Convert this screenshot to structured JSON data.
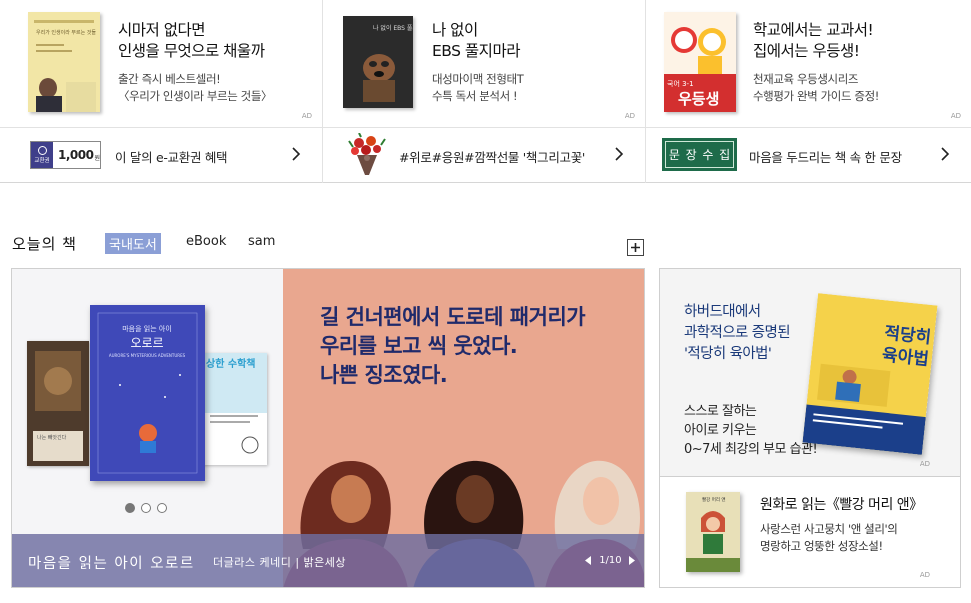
{
  "top_ads": [
    {
      "title": "시마저 없다면\n인생을 무엇으로 채울까",
      "subtitle": "출간 즉시 베스트셀러!\n〈우리가 인생이라 부르는 것들〉",
      "cover_text": "우리가 인생이라 부르는 것들",
      "ad_mark": "AD"
    },
    {
      "title": "나 없이\nEBS 풀지마라",
      "subtitle": "대성마이맥 전형태T\n수특 독서 분석서 !",
      "cover_text": "나 없이 EBS 풀지마라",
      "ad_mark": "AD"
    },
    {
      "title": "학교에서는 교과서!\n집에서는 우등생!",
      "subtitle": "천재교육 우등생시리즈\n수행평가 완벽 가이드 증정!",
      "cover_text": "우등생",
      "cover_sub": "국어 3-1",
      "ad_mark": "AD"
    }
  ],
  "links": [
    {
      "badge_label": "교환권",
      "badge_amount": "1,000",
      "badge_unit": "원",
      "text": "이 달의 e-교환권 혜택"
    },
    {
      "text": "#위로#응원#깜짝선물 '책그리고꽃'"
    },
    {
      "stamp": [
        "문",
        "장",
        "수",
        "집"
      ],
      "text": "마음을 두드리는 책 속 한 문장"
    }
  ],
  "section": {
    "title": "오늘의 책",
    "tabs": [
      "국내도서",
      "eBook",
      "sam"
    ],
    "active_tab": 0
  },
  "banner": {
    "quote": "길 건너편에서 도로테 패거리가\n우리를 보고 씩 웃었다.\n나쁜 징조였다.",
    "book_title": "마음을 읽는 아이 오로르",
    "author_publisher": "더글라스 케네디 | 밝은세상",
    "pager": "1/10",
    "cover_main_top": "마음을 읽는 아이",
    "cover_main_title": "오로르",
    "cover_main_sub": "AURORE'S MYSTERIOUS ADVENTURES",
    "cover_right_text": "상한 수학책",
    "cover_left_text": "나는 빼앗긴다"
  },
  "side_ad1": {
    "title": "하버드대에서\n과학적으로 증명된\n'적당히 육아법'",
    "subtitle": "스스로 잘하는\n아이로 키우는\n0~7세 최강의 부모 습관!",
    "cover_text": "적당히\n육아법",
    "ad_mark": "AD"
  },
  "side_ad2": {
    "title": "원화로 읽는《빨강 머리 앤》",
    "subtitle": "사랑스런 사고뭉치 '앤 셜리'의\n명랑하고 엉뚱한 성장소설!",
    "cover_text": "빨강 머리 앤",
    "ad_mark": "AD"
  },
  "colors": {
    "tab_active_bg": "#8b9fd6",
    "banner_right_bg": "#e9a78f",
    "quote_text": "#1f2a6b",
    "stamp_green": "#1e6b4a"
  }
}
